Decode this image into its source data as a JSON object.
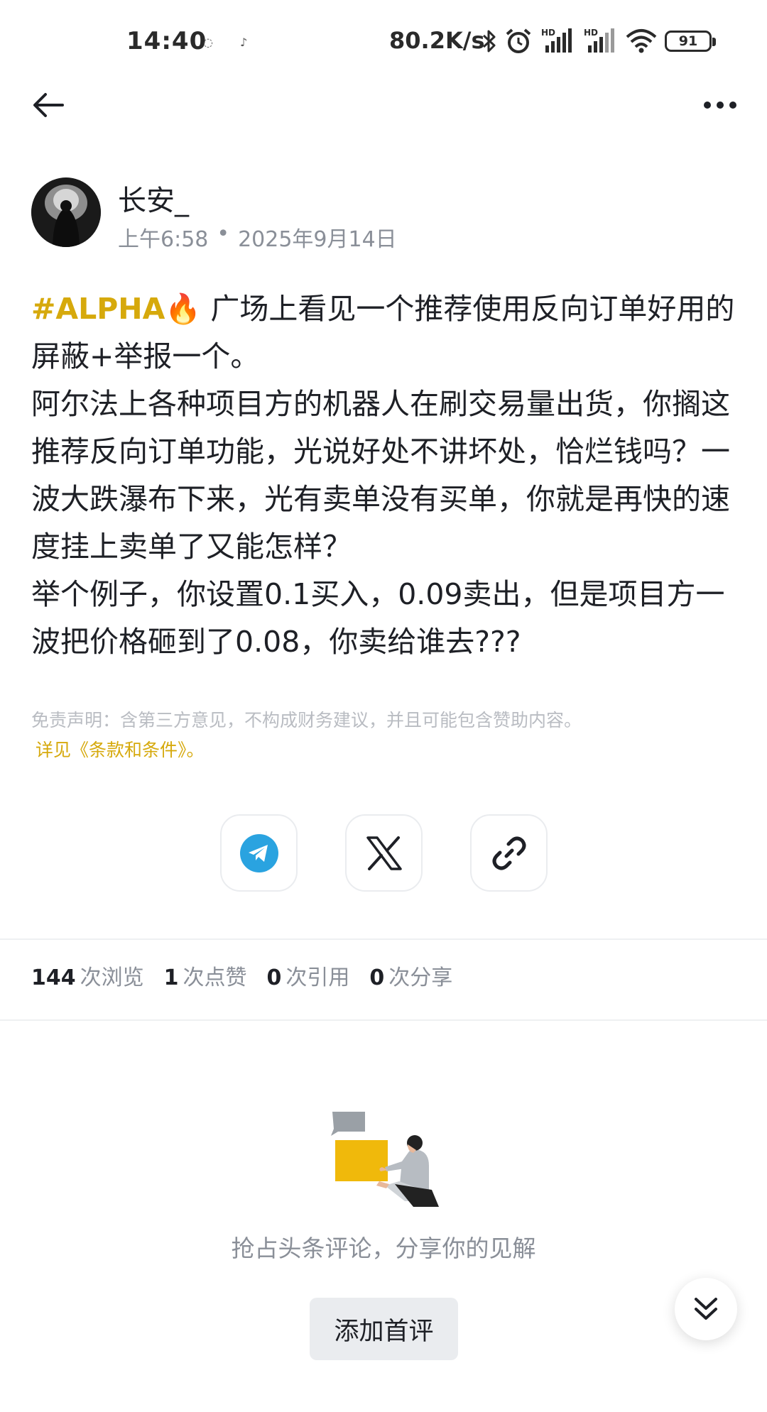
{
  "status_bar": {
    "time": "14:40",
    "net_speed": "80.2K/s",
    "battery": "91",
    "icons": [
      "notification-icon",
      "music-icon",
      "bluetooth-icon",
      "alarm-icon",
      "signal-hd-icon",
      "signal-hd-icon",
      "wifi-icon",
      "battery-icon"
    ]
  },
  "nav": {
    "back_icon": "arrow-left-icon",
    "more_icon": "more-horizontal-icon"
  },
  "author": {
    "name": "长安_",
    "time": "上午6:58",
    "separator": "•",
    "date": "2025年9月14日"
  },
  "post": {
    "hashtag": "#ALPHA🔥",
    "lines": [
      " 广场上看见一个推荐使用反向订单好用的屏蔽+举报一个。",
      "阿尔法上各种项目方的机器人在刷交易量出货，你搁这推荐反向订单功能，光说好处不讲坏处，恰烂钱吗？一波大跌瀑布下来，光有卖单没有买单，你就是再快的速度挂上卖单了又能怎样？",
      "举个例子，你设置0.1买入，0.09卖出，但是项目方一波把价格砸到了0.08，你卖给谁去???"
    ],
    "disclaimer": "免责声明：含第三方意见，不构成财务建议，并且可能包含赞助内容。",
    "disclaimer_link": "详见《条款和条件》。"
  },
  "share": {
    "buttons": [
      "telegram-icon",
      "x-icon",
      "link-icon"
    ]
  },
  "stats": {
    "views_num": "144",
    "views_label": "次浏览",
    "likes_num": "1",
    "likes_label": "次点赞",
    "quotes_num": "0",
    "quotes_label": "次引用",
    "shares_num": "0",
    "shares_label": "次分享"
  },
  "comments": {
    "empty_text": "抢占头条评论，分享你的见解",
    "add_button": "添加首评",
    "scroll_icon": "double-chevron-down-icon"
  },
  "colors": {
    "accent": "#d6a90c",
    "text_primary": "#1e2026",
    "text_secondary": "#8a8f98",
    "telegram": "#2aa3e0"
  }
}
